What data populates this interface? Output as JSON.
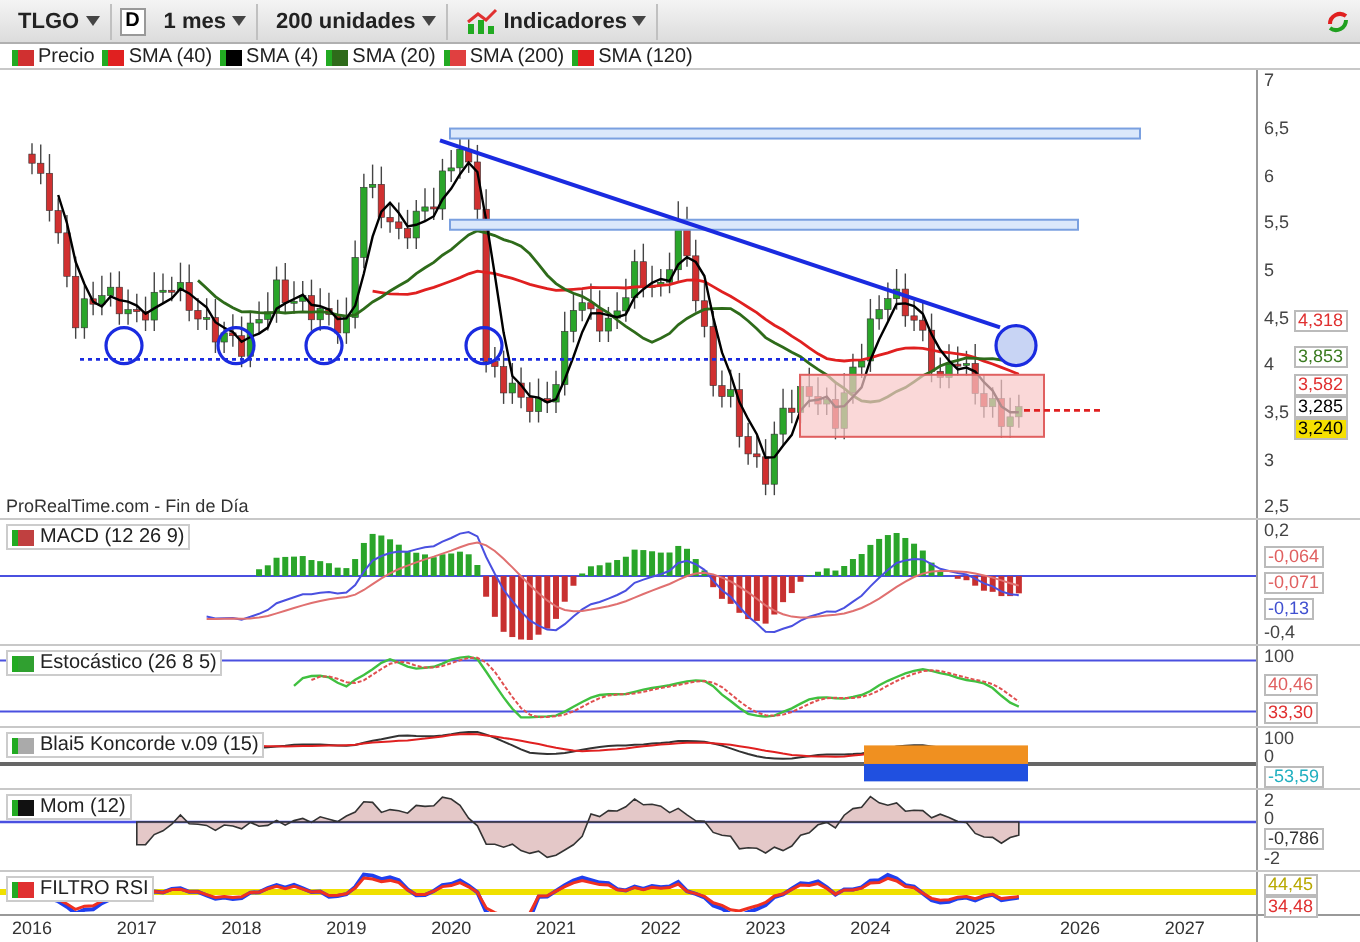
{
  "toolbar": {
    "symbol": "TLGO",
    "chart_type": "D",
    "period": "1 mes",
    "units": "200 unidades",
    "indicators": "Indicadores"
  },
  "legend": [
    {
      "label": "Precio",
      "color": "#d03030"
    },
    {
      "label": "SMA (40)",
      "color": "#e02020"
    },
    {
      "label": "SMA (4)",
      "color": "#000000"
    },
    {
      "label": "SMA (20)",
      "color": "#2e6b1a"
    },
    {
      "label": "SMA (200)",
      "color": "#e04040"
    },
    {
      "label": "SMA (120)",
      "color": "#e02020"
    }
  ],
  "price_axis": [
    "7",
    "6,5",
    "6",
    "5,5",
    "5",
    "4,5",
    "4",
    "3,5",
    "3",
    "2,5"
  ],
  "price_labels": [
    {
      "text": "4,318",
      "color": "#e03030",
      "highlight": false
    },
    {
      "text": "3,853",
      "color": "#3a7a20",
      "highlight": false
    },
    {
      "text": "3,582",
      "color": "#e03030",
      "highlight": false
    },
    {
      "text": "3,285",
      "color": "#000000",
      "highlight": false
    },
    {
      "text": "3,240",
      "highlight": true
    }
  ],
  "source": "ProRealTime.com - Fin de Día",
  "panels": [
    {
      "kind": "macd",
      "title": "MACD (12 26 9)",
      "axis": [
        {
          "kind": "tick",
          "text": "0,2"
        },
        {
          "kind": "value",
          "text": "-0,064",
          "color": "#e06060"
        },
        {
          "kind": "value",
          "text": "-0,071",
          "color": "#e06060"
        },
        {
          "kind": "value",
          "text": "-0,13",
          "color": "#4050d0"
        },
        {
          "kind": "tick",
          "text": "-0,4"
        }
      ]
    },
    {
      "kind": "stochastic",
      "title": "Estocástico (26 8 5)",
      "axis": [
        {
          "kind": "tick",
          "text": "100"
        },
        {
          "kind": "value",
          "text": "40,46",
          "color": "#e06060"
        },
        {
          "kind": "value",
          "text": "33,30",
          "color": "#e03030"
        }
      ]
    },
    {
      "kind": "koncorde",
      "title": "Blai5 Koncorde v.09 (15)",
      "axis": [
        {
          "kind": "tick",
          "text": "100"
        },
        {
          "kind": "tick",
          "text": "0"
        },
        {
          "kind": "value",
          "text": "-53,59",
          "color": "#20b0c0"
        }
      ]
    },
    {
      "kind": "momentum",
      "title": "Mom (12)",
      "axis": [
        {
          "kind": "tick",
          "text": "2"
        },
        {
          "kind": "tick",
          "text": "0"
        },
        {
          "kind": "value",
          "text": "-0,786",
          "color": "#333333"
        },
        {
          "kind": "tick",
          "text": "-2"
        }
      ]
    },
    {
      "kind": "rsi",
      "title": "FILTRO RSI",
      "axis": [
        {
          "kind": "value",
          "text": "44,45",
          "color": "#b8a800"
        },
        {
          "kind": "value",
          "text": "34,48",
          "color": "#e03030"
        }
      ]
    }
  ],
  "x_axis": [
    "2016",
    "2017",
    "2018",
    "2019",
    "2020",
    "2021",
    "2022",
    "2023",
    "2024",
    "2025",
    "2026",
    "2027"
  ]
}
